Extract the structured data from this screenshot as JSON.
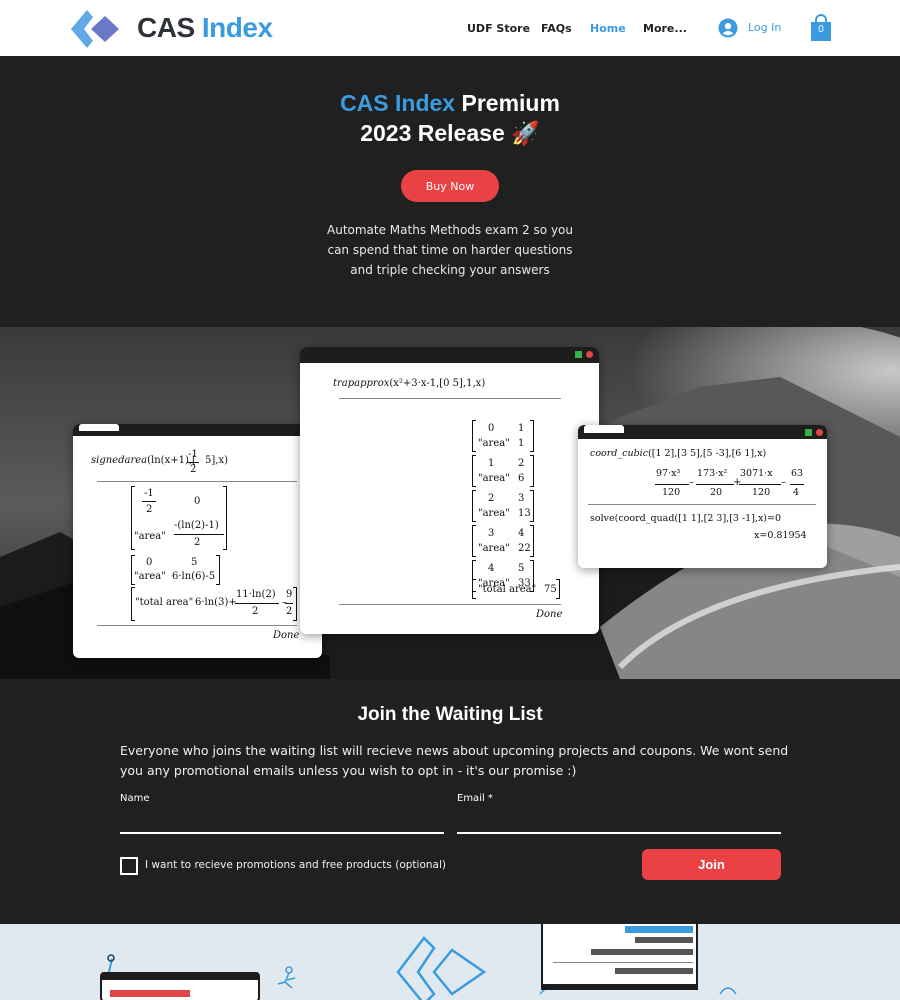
{
  "header": {
    "brand_part1": "CAS",
    "brand_part2": "Index",
    "nav": [
      "UDF Store",
      "FAQs",
      "Home",
      "More..."
    ],
    "active_nav": "Home",
    "login_label": "Log In",
    "cart_count": "0"
  },
  "hero": {
    "title_blue": "CAS Index",
    "title_white": "Premium",
    "title_line2": "2023 Release",
    "title_emoji": "🚀",
    "buy_label": "Buy Now",
    "description": "Automate Maths Methods exam 2 so you can spend that time on harder questions and triple checking your answers"
  },
  "windows": {
    "left": {
      "command": "signedarea(ln(x+1),[-1/2 5],x)",
      "cmd_fn": "signedarea",
      "r1a": "-1",
      "r1b": "2",
      "r1c": "0",
      "r2a": "\"area\"",
      "r2b": "-(ln(2)-1)",
      "r2c": "2",
      "r3a": "0",
      "r3b": "5",
      "r4a": "\"area\"",
      "r4b": "6·ln(6)-5",
      "r5a": "\"total area\"",
      "r5b": "6·ln(3)+",
      "r5c": "11·ln(2)",
      "r5d": "2",
      "r5e": "9",
      "r5f": "2",
      "done": "Done"
    },
    "middle": {
      "cmd_fn": "trapapprox",
      "cmd_args": "x²+3·x-1,[0  5],1,x",
      "rows": [
        {
          "a": "0",
          "b": "1",
          "c": "\"area\"",
          "d": "1"
        },
        {
          "a": "1",
          "b": "2",
          "c": "\"area\"",
          "d": "6"
        },
        {
          "a": "2",
          "b": "3",
          "c": "\"area\"",
          "d": "13"
        },
        {
          "a": "3",
          "b": "4",
          "c": "\"area\"",
          "d": "22"
        },
        {
          "a": "4",
          "b": "5",
          "c": "\"area\"",
          "d": "33"
        }
      ],
      "total_label": "\"total area\"",
      "total_value": "75",
      "done": "Done"
    },
    "right": {
      "cmd1_fn": "coord_cubic",
      "cmd1_args": "[1  2],[3  5],[5  -3],[6  1],x",
      "n1": "97·x³",
      "d1": "120",
      "n2": "173·x²",
      "d2": "20",
      "n3": "3071·x",
      "d3": "120",
      "n4": "63",
      "d4": "4",
      "cmd2": "solve(coord_quad([1  1],[2  3],[3  -1],x)=0",
      "result": "x=0.81954"
    }
  },
  "waiting_list": {
    "title": "Join the Waiting List",
    "description": "Everyone who joins the waiting list will recieve news about upcoming projects and coupons. We wont send you any promotional emails unless you wish to opt in - it's our promise :)",
    "name_label": "Name",
    "email_label": "Email *",
    "checkbox_label": "I want to recieve promotions and free products (optional)",
    "join_label": "Join"
  },
  "colors": {
    "accent_blue": "#3b9be0",
    "accent_red": "#ea4145",
    "dark_bg": "#1f2120"
  }
}
